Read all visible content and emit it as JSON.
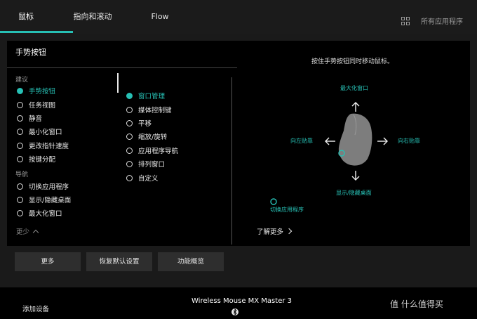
{
  "tabs": [
    {
      "label": "鼠标"
    },
    {
      "label": "指向和滚动"
    },
    {
      "label": "Flow"
    }
  ],
  "header": {
    "app_select": "所有应用程序",
    "icon": "grid-icon"
  },
  "panel": {
    "title": "手势按钮",
    "hint": "按住手势按钮同时移动鼠标。",
    "sections": {
      "suggest": "建议",
      "navigate": "导航"
    },
    "list1": [
      "手势按钮",
      "任务视图",
      "静音",
      "最小化窗口",
      "更改指针速度",
      "按键分配"
    ],
    "list2": [
      "切换应用程序",
      "显示/隐藏桌面",
      "最大化窗口"
    ],
    "less": "更少",
    "list3": [
      "窗口管理",
      "媒体控制键",
      "平移",
      "缩放/旋转",
      "应用程序导航",
      "排列窗口",
      "自定义"
    ],
    "directions": {
      "up": "最大化窗口",
      "left": "向左贴靠",
      "right": "向右贴靠",
      "down": "显示/隐藏桌面",
      "click": "切换应用程序"
    },
    "learn_more": "了解更多"
  },
  "buttons": {
    "more": "更多",
    "restore": "恢复默认设置",
    "overview": "功能概览"
  },
  "footer": {
    "add_device": "添加设备",
    "device": "Wireless Mouse MX Master 3",
    "watermark": "值 什么值得买"
  },
  "colors": {
    "accent": "#27c0b5",
    "panel_bg": "#000000",
    "app_bg": "#1a1a1a"
  }
}
